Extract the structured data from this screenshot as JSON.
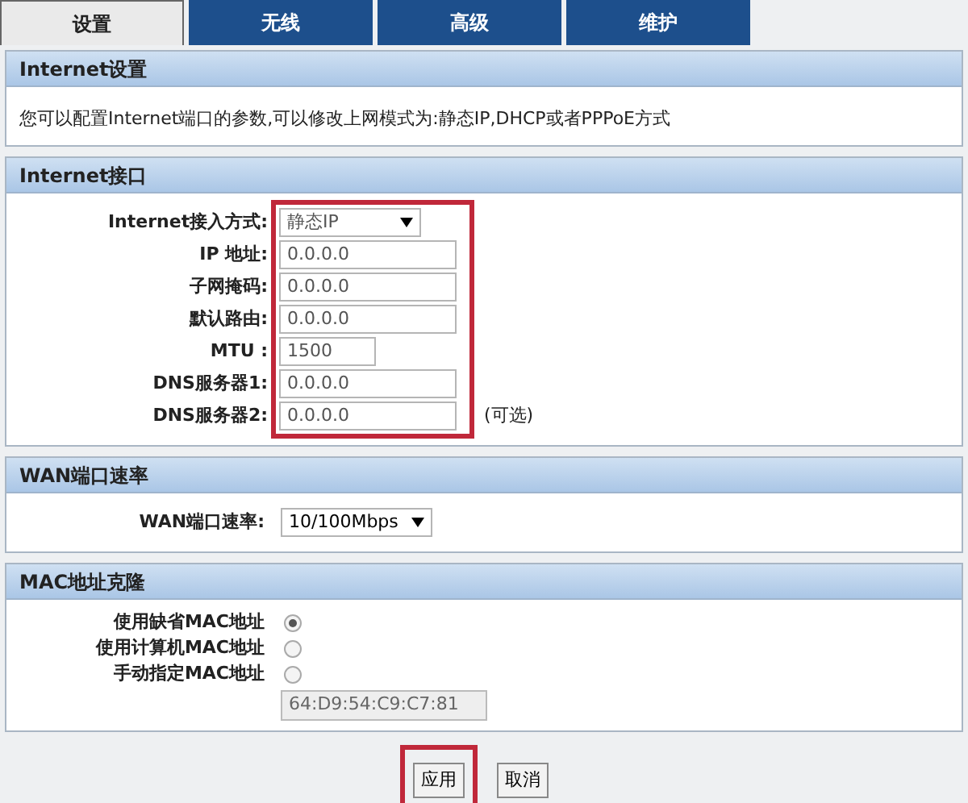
{
  "tabs": [
    {
      "label": "设置",
      "selected": true
    },
    {
      "label": "无线",
      "selected": false
    },
    {
      "label": "高级",
      "selected": false
    },
    {
      "label": "维护",
      "selected": false
    }
  ],
  "internet_settings": {
    "title": "Internet设置",
    "description": "您可以配置Internet端口的参数,可以修改上网模式为:静态IP,DHCP或者PPPoE方式"
  },
  "internet_port": {
    "title": "Internet接口",
    "highlighted": true,
    "fields": [
      {
        "kind": "select",
        "label": "Internet接入方式:",
        "value": "静态IP"
      },
      {
        "kind": "input",
        "label": "IP 地址:",
        "value": "0.0.0.0"
      },
      {
        "kind": "input",
        "label": "子网掩码:",
        "value": "0.0.0.0"
      },
      {
        "kind": "input",
        "label": "默认路由:",
        "value": "0.0.0.0"
      },
      {
        "kind": "short",
        "label": "MTU :",
        "value": "1500"
      },
      {
        "kind": "input",
        "label": "DNS服务器1:",
        "value": "0.0.0.0"
      },
      {
        "kind": "input",
        "label": "DNS服务器2:",
        "value": "0.0.0.0",
        "note": "(可选)"
      }
    ]
  },
  "wan_speed": {
    "title": "WAN端口速率",
    "label": "WAN端口速率:",
    "value": "10/100Mbps"
  },
  "mac_clone": {
    "title": "MAC地址克隆",
    "options": [
      {
        "label": "使用缺省MAC地址",
        "selected": true
      },
      {
        "label": "使用计算机MAC地址",
        "selected": false
      },
      {
        "label": "手动指定MAC地址",
        "selected": false
      }
    ],
    "mac_value": "64:D9:54:C9:C7:81"
  },
  "buttons": [
    {
      "label": "应用",
      "highlighted": true
    },
    {
      "label": "取消",
      "highlighted": false
    }
  ]
}
